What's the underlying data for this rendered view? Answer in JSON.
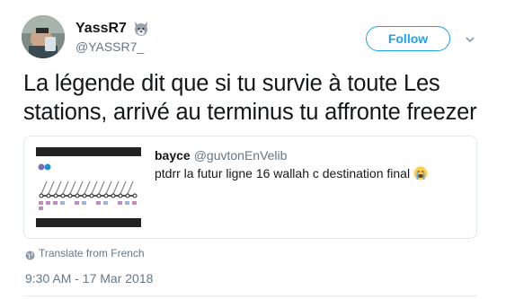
{
  "tweet": {
    "author": {
      "name": "YassR7",
      "handle": "@YASSR7_"
    },
    "follow_label": "Follow",
    "text": "La légende dit que si tu survie à toute Les stations, arrivé au terminus tu affronte freezer",
    "translate_label": "Translate from French",
    "timestamp": "9:30 AM - 17 Mar 2018"
  },
  "quote": {
    "name": "bayce",
    "handle": "@guvtonEnVelib",
    "text": "ptdrr la futur ligne 16 wallah c destination final"
  },
  "icons": {
    "wolf": "wolf-face-emoji",
    "chevron": "chevron-down-icon",
    "crying": "loudly-crying-face-emoji",
    "globe": "globe-icon"
  },
  "colors": {
    "accent": "#1da1f2",
    "secondary_text": "#657786",
    "border": "#e1e8ed"
  }
}
